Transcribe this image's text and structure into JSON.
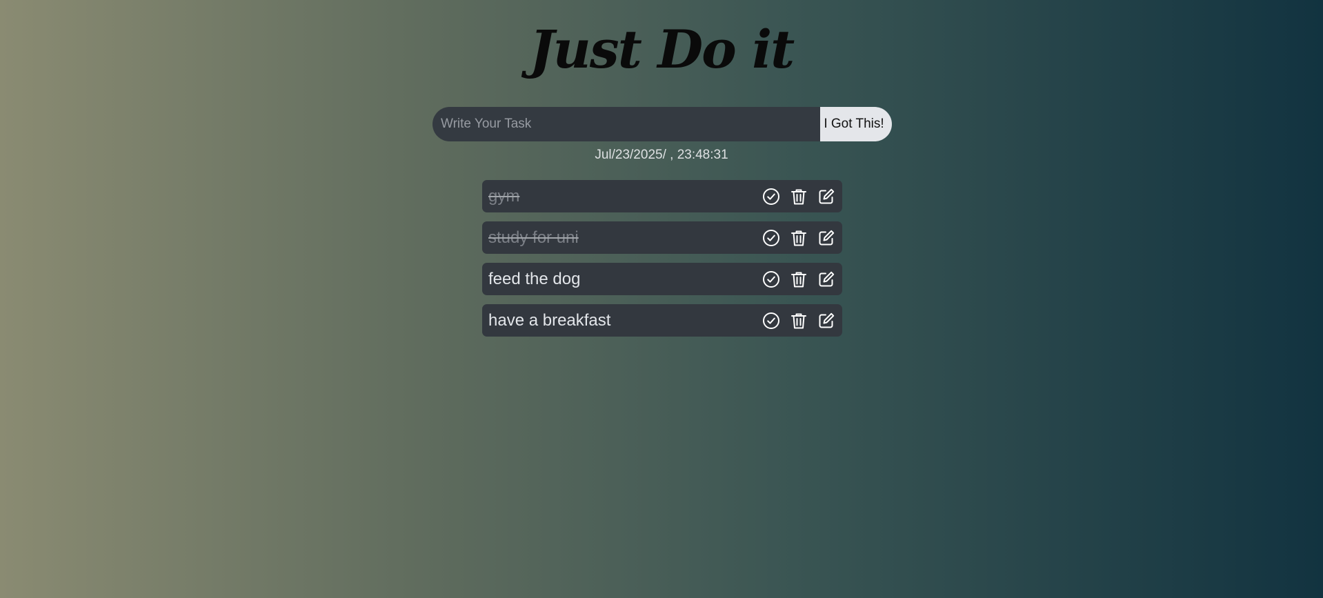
{
  "app": {
    "title": "Just Do it"
  },
  "form": {
    "placeholder": "Write Your Task",
    "value": "",
    "button_label": "I Got This!"
  },
  "datetime": "Jul/23/2025/ , 23:48:31",
  "tasks": [
    {
      "text": "gym",
      "done": true
    },
    {
      "text": "study for uni",
      "done": true
    },
    {
      "text": "feed the dog",
      "done": false
    },
    {
      "text": "have a breakfast",
      "done": false
    }
  ],
  "icons": {
    "complete": "check-circle-icon",
    "delete": "trash-icon",
    "edit": "edit-icon"
  },
  "colors": {
    "gradient_start": "#8a8b72",
    "gradient_end": "#123340",
    "panel": "#33383f",
    "button": "#e4e6ea"
  }
}
